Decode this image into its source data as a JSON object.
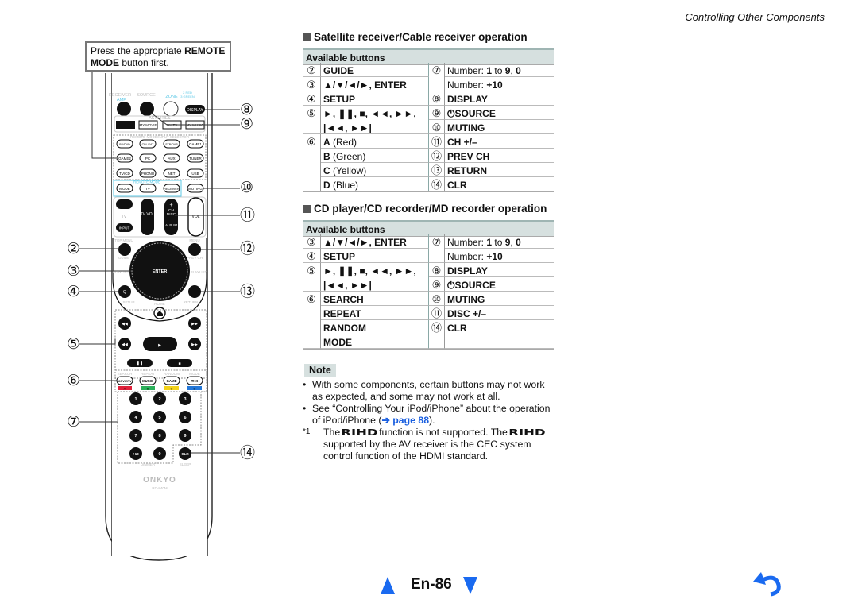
{
  "header": {
    "title": "Controlling Other Components"
  },
  "press_box": {
    "pre": "Press the appropriate ",
    "bold1": "REMOTE",
    "bold2": "MODE",
    "post": " button first."
  },
  "callouts": {
    "n2": "②",
    "n3": "③",
    "n4": "④",
    "n5": "⑤",
    "n6": "⑥",
    "n7": "⑦",
    "n8": "⑧",
    "n9": "⑨",
    "n10": "⑩",
    "n11": "⑪",
    "n12": "⑫",
    "n13": "⑬",
    "n14": "⑭"
  },
  "remote": {
    "receiver": "RECEIVER",
    "amp": "AMP",
    "source": "SOURCE",
    "zone": "ZONE",
    "zone_sub1": "2 RED",
    "zone_sub2": "3 GREEN",
    "display": "DISPLAY",
    "activities": "ACTIVITIES",
    "my_movie": "MY MOVIE",
    "my_tv": "MY TV",
    "my_music": "MY MUSIC",
    "selector": "REMOTE MODE/INPUT SELECTOR",
    "inputs": [
      "BD/DVD",
      "CBL/SAT",
      "STB/DVR",
      "GAME1",
      "GAME2",
      "PC",
      "AUX",
      "TUNER",
      "TV/CD",
      "PHONO",
      "NET",
      "USB"
    ],
    "remote_mode": "REMOTE MODE",
    "mode": "MODE",
    "tv": "TV",
    "receiver_btn": "RECEIVER",
    "muting": "MUTING",
    "tv_label": "TV",
    "input": "INPUT",
    "tv_vol": "TV\nVOL",
    "ch": "CH",
    "disc": "DISC",
    "album": "ALBUM",
    "vol": "VOL",
    "top_menu": "TOP MENU",
    "menu": "MENU",
    "guide": "GUIDE",
    "prev_ch": "PREV CH",
    "enter": "ENTER",
    "playlist_l": "PLAYLIST",
    "playlist_r": "PLAYLIST",
    "setup": "SETUP",
    "return": "RETURN",
    "home": "HOME",
    "search": "SEARCH",
    "repeat": "REPEAT",
    "random": "RANDOM",
    "mode2": "MODE",
    "movie_tv": "MOVIE/TV",
    "music": "MUSIC",
    "game": "GAME",
    "thx": "THX",
    "colors": [
      {
        "label": "A",
        "color": "#e0203a"
      },
      {
        "label": "B",
        "color": "#2bb05a"
      },
      {
        "label": "C",
        "color": "#f2d21a"
      },
      {
        "label": "D",
        "color": "#2377d8"
      }
    ],
    "digits": [
      "1",
      "2",
      "3",
      "4",
      "5",
      "6",
      "7",
      "8",
      "9",
      "+10",
      "0",
      "CLR"
    ],
    "dimmer": "DIMMER",
    "sleep": "SLEEP",
    "brand": "ONKYO",
    "model": "RC-840M"
  },
  "sections": [
    {
      "title": "Satellite receiver/Cable receiver operation",
      "table_header": "Available buttons",
      "left": [
        {
          "n": "②",
          "items": [
            [
              [
                [
                  "GUIDE",
                  true
                ]
              ]
            ]
          ]
        },
        {
          "n": "③",
          "items": [
            [
              [
                [
                  "▲/▼/◄/►, ENTER",
                  true
                ]
              ]
            ]
          ]
        },
        {
          "n": "④",
          "items": [
            [
              [
                [
                  "SETUP",
                  true
                ]
              ]
            ]
          ]
        },
        {
          "n": "⑤",
          "items": [
            [
              [
                [
                  "►, ❚❚, ■, ◄◄, ►►,",
                  true
                ]
              ],
              [
                [
                  "|◄◄, ►►|",
                  true
                ]
              ]
            ]
          ]
        },
        {
          "n": "⑥",
          "items": [
            [
              [
                [
                  "A",
                  true
                ],
                [
                  " (Red)",
                  false
                ]
              ]
            ],
            [
              [
                [
                  "B",
                  true
                ],
                [
                  " (Green)",
                  false
                ]
              ]
            ],
            [
              [
                [
                  "C",
                  true
                ],
                [
                  " (Yellow)",
                  false
                ]
              ]
            ],
            [
              [
                [
                  "D",
                  true
                ],
                [
                  " (Blue)",
                  false
                ]
              ]
            ]
          ]
        }
      ],
      "right": [
        {
          "n": "⑦",
          "items": [
            [
              [
                [
                  "Number: ",
                  false
                ],
                [
                  "1",
                  true
                ],
                [
                  " to ",
                  false
                ],
                [
                  "9",
                  true
                ],
                [
                  ", ",
                  false
                ],
                [
                  "0",
                  true
                ]
              ]
            ],
            [
              [
                [
                  "Number: ",
                  false
                ],
                [
                  "+10",
                  true
                ]
              ]
            ]
          ]
        },
        {
          "n": "⑧",
          "items": [
            [
              [
                [
                  "DISPLAY",
                  true
                ]
              ]
            ]
          ]
        },
        {
          "n": "⑨",
          "items": [
            [
              [
                [
                  "⏻SOURCE",
                  true
                ]
              ]
            ]
          ]
        },
        {
          "n": "⑩",
          "items": [
            [
              [
                [
                  "MUTING",
                  true
                ]
              ]
            ]
          ]
        },
        {
          "n": "⑪",
          "items": [
            [
              [
                [
                  "CH +/–",
                  true
                ]
              ]
            ]
          ]
        },
        {
          "n": "⑫",
          "items": [
            [
              [
                [
                  "PREV CH",
                  true
                ]
              ]
            ]
          ]
        },
        {
          "n": "⑬",
          "items": [
            [
              [
                [
                  "RETURN",
                  true
                ]
              ]
            ]
          ]
        },
        {
          "n": "⑭",
          "items": [
            [
              [
                [
                  "CLR",
                  true
                ]
              ]
            ]
          ]
        }
      ]
    },
    {
      "title": "CD player/CD recorder/MD recorder operation",
      "table_header": "Available buttons",
      "left": [
        {
          "n": "③",
          "items": [
            [
              [
                [
                  "▲/▼/◄/►, ENTER",
                  true
                ]
              ]
            ]
          ]
        },
        {
          "n": "④",
          "items": [
            [
              [
                [
                  "SETUP",
                  true
                ]
              ]
            ]
          ]
        },
        {
          "n": "⑤",
          "items": [
            [
              [
                [
                  "►, ❚❚, ■, ◄◄, ►►,",
                  true
                ]
              ],
              [
                [
                  "|◄◄, ►►|",
                  true
                ]
              ]
            ]
          ]
        },
        {
          "n": "⑥",
          "items": [
            [
              [
                [
                  "SEARCH",
                  true
                ]
              ]
            ],
            [
              [
                [
                  "REPEAT",
                  true
                ]
              ]
            ],
            [
              [
                [
                  "RANDOM",
                  true
                ]
              ]
            ],
            [
              [
                [
                  "MODE",
                  true
                ]
              ]
            ]
          ]
        }
      ],
      "right": [
        {
          "n": "⑦",
          "items": [
            [
              [
                [
                  "Number: ",
                  false
                ],
                [
                  "1",
                  true
                ],
                [
                  " to ",
                  false
                ],
                [
                  "9",
                  true
                ],
                [
                  ", ",
                  false
                ],
                [
                  "0",
                  true
                ]
              ]
            ],
            [
              [
                [
                  "Number: ",
                  false
                ],
                [
                  "+10",
                  true
                ]
              ]
            ]
          ]
        },
        {
          "n": "⑧",
          "items": [
            [
              [
                [
                  "DISPLAY",
                  true
                ]
              ]
            ]
          ]
        },
        {
          "n": "⑨",
          "items": [
            [
              [
                [
                  "⏻SOURCE",
                  true
                ]
              ]
            ]
          ]
        },
        {
          "n": "⑩",
          "items": [
            [
              [
                [
                  "MUTING",
                  true
                ]
              ]
            ]
          ]
        },
        {
          "n": "⑪",
          "items": [
            [
              [
                [
                  "DISC +/–",
                  true
                ]
              ]
            ]
          ]
        },
        {
          "n": "⑭",
          "items": [
            [
              [
                [
                  "CLR",
                  true
                ]
              ]
            ]
          ]
        },
        {
          "n": "",
          "items": [
            [
              [
                [
                  "",
                  false
                ]
              ]
            ]
          ]
        }
      ]
    }
  ],
  "note": {
    "label": "Note",
    "bullet1": "With some components, certain buttons may not work as expected, and some may not work at all.",
    "bullet2_pre": "See “Controlling Your iPod/iPhone” about the operation of iPod/iPhone (",
    "bullet2_link": "➔ page 88",
    "bullet2_post": ").",
    "fn_mark": "*1",
    "fn_a": "The",
    "rihd": "RIHD",
    "fn_b": "function is not supported. The",
    "fn_c": "supported by the AV receiver is the CEC system control function of the HDMI standard."
  },
  "footer": {
    "page": "En-86",
    "prev_icon": "triangle-up-icon",
    "next_icon": "triangle-down-icon",
    "back_icon": "return-arrow-icon",
    "accent": "#1a6af0"
  }
}
